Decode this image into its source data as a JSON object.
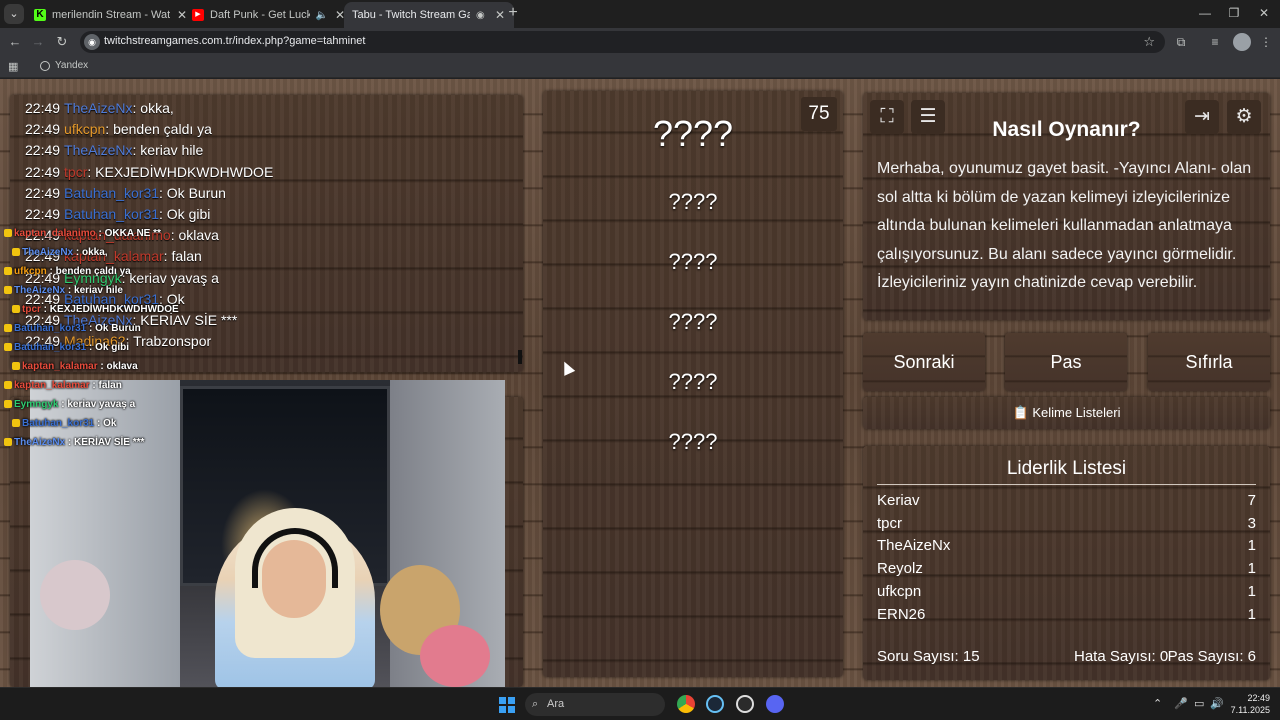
{
  "browser": {
    "tabs": [
      {
        "title": "merilendin Stream - Watch Live",
        "favicon_color": "#53fc18",
        "favicon_glyph": "K",
        "active": false
      },
      {
        "title": "Daft Punk - Get Lucky (Feat.",
        "favicon_color": "#ff0000",
        "favicon_glyph": "▶",
        "active": false
      },
      {
        "title": "Tabu - Twitch Stream Games",
        "favicon_color": "#5f6368",
        "favicon_glyph": "",
        "active": true
      }
    ],
    "url": "twitchstreamgames.com.tr/index.php?game=tahminet",
    "bookmark": "Yandex"
  },
  "chat": {
    "messages": [
      {
        "time": "22:49",
        "user": "TheAizeNx",
        "color": "#4f7bd8",
        "text": "okka,"
      },
      {
        "time": "22:49",
        "user": "ufkcpn",
        "color": "#e69a2b",
        "text": "benden çaldı ya"
      },
      {
        "time": "22:49",
        "user": "TheAizeNx",
        "color": "#4f7bd8",
        "text": "keriav hile"
      },
      {
        "time": "22:49",
        "user": "tpcr",
        "color": "#c0392b",
        "text": "KEXJEDİWHDKWDHWDOE"
      },
      {
        "time": "22:49",
        "user": "Batuhan_kor31",
        "color": "#3a6fd1",
        "text": "Ok Burun"
      },
      {
        "time": "22:49",
        "user": "Batuhan_kor31",
        "color": "#3a6fd1",
        "text": "Ok gibi"
      },
      {
        "time": "22:49",
        "user": "kaptan_dalanimo",
        "color": "#c0392b",
        "text": "oklava"
      },
      {
        "time": "22:49",
        "user": "kaptan_kalamar",
        "color": "#c0392b",
        "text": "falan"
      },
      {
        "time": "22:49",
        "user": "Eymngyk",
        "color": "#2ecc71",
        "text": "keriav yavaş a"
      },
      {
        "time": "22:49",
        "user": "Batuhan_kor31",
        "color": "#3a6fd1",
        "text": "Ok"
      },
      {
        "time": "22:49",
        "user": "TheAizeNx",
        "color": "#4f7bd8",
        "text": "KERİAV SİE ***"
      },
      {
        "time": "22:49",
        "user": "Madina62",
        "color": "#e69a2b",
        "text": "Trabzonspor"
      }
    ]
  },
  "overlay": {
    "lines": [
      {
        "user": "kaptan_dalanimo",
        "color": "#e74c3c",
        "text": "OKKA NE **"
      },
      {
        "user": "TheAizeNx",
        "color": "#5b8def",
        "text": "okka,"
      },
      {
        "user": "ufkcpn",
        "color": "#f39c12",
        "text": "benden çaldı ya"
      },
      {
        "user": "TheAizeNx",
        "color": "#5b8def",
        "text": "keriav hile"
      },
      {
        "user": "tpcr",
        "color": "#e74c3c",
        "text": "KEXJEDİWHDKWDHWDOE"
      },
      {
        "user": "Batuhan_kor31",
        "color": "#3a6fd1",
        "text": "Ok Burun"
      },
      {
        "user": "Batuhan_kor31",
        "color": "#3a6fd1",
        "text": "Ok gibi"
      },
      {
        "user": "kaptan_kalamar",
        "color": "#e74c3c",
        "text": "oklava"
      },
      {
        "user": "kaptan_kalamar",
        "color": "#e74c3c",
        "text": "falan"
      },
      {
        "user": "Eymngyk",
        "color": "#2ecc71",
        "text": "keriav yavaş a"
      },
      {
        "user": "Batuhan_kor31",
        "color": "#3a6fd1",
        "text": "Ok"
      },
      {
        "user": "TheAizeNx",
        "color": "#5b8def",
        "text": "KERİAV SİE ***"
      }
    ]
  },
  "game": {
    "timer": "75",
    "main_word": "????",
    "taboo_words": [
      "????",
      "????",
      "????",
      "????",
      "????"
    ]
  },
  "howto": {
    "title": "Nasıl Oynanır?",
    "text": "Merhaba, oyunumuz gayet basit. -Yayıncı Alanı- olan sol altta ki bölüm de yazan kelimeyi izleyicilerinize altında bulunan kelimeleri kullanmadan anlatmaya çalışıyorsunuz. Bu alanı sadece yayıncı görmelidir. İzleyicileriniz yayın chatinizde cevap verebilir."
  },
  "buttons": {
    "next": "Sonraki",
    "pass": "Pas",
    "reset": "Sıfırla",
    "word_lists": "Kelime Listeleri"
  },
  "leaderboard": {
    "title": "Liderlik Listesi",
    "rows": [
      {
        "name": "Keriav",
        "score": "7"
      },
      {
        "name": "tpcr",
        "score": "3"
      },
      {
        "name": "TheAizeNx",
        "score": "1"
      },
      {
        "name": "Reyolz",
        "score": "1"
      },
      {
        "name": "ufkcpn",
        "score": "1"
      },
      {
        "name": "ERN26",
        "score": "1"
      }
    ],
    "questions": "Soru Sayısı: 15",
    "errors": "Hata Sayısı: 0",
    "passes": "Pas Sayısı: 6"
  },
  "taskbar": {
    "search_label": "Ara",
    "time": "22:49",
    "date": "7.11.2025"
  }
}
